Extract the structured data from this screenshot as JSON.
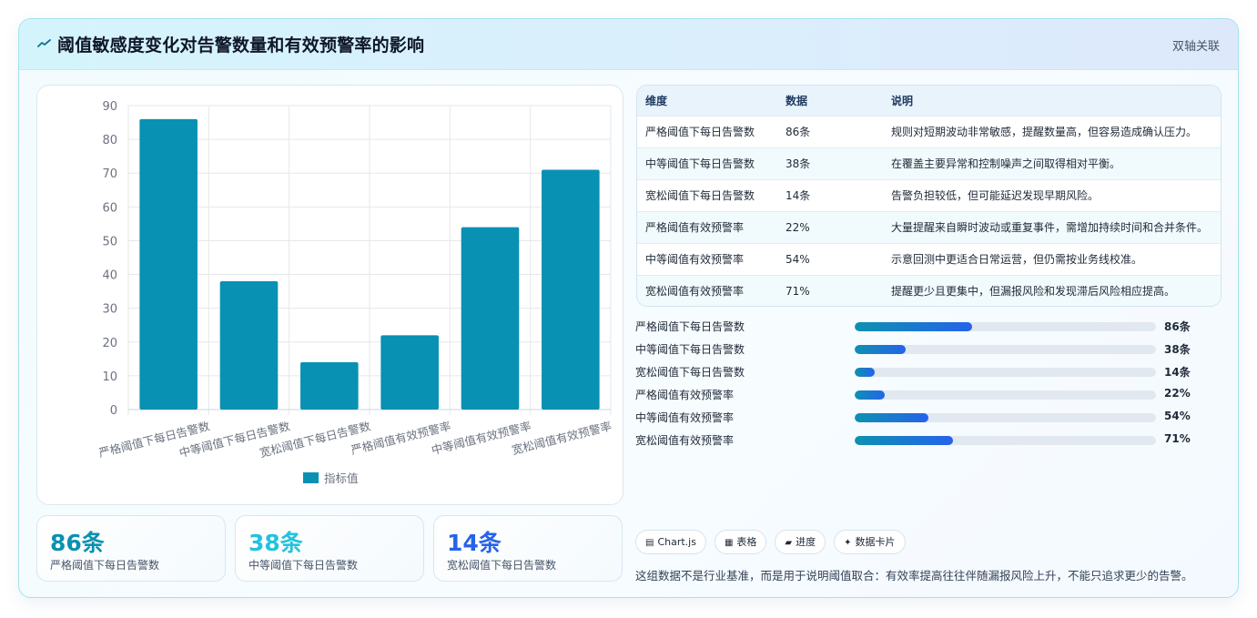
{
  "header": {
    "title": "阈值敏感度变化对告警数量和有效预警率的影响",
    "tag": "双轴关联"
  },
  "chart_data": {
    "type": "bar",
    "categories": [
      "严格阈值下每日告警数",
      "中等阈值下每日告警数",
      "宽松阈值下每日告警数",
      "严格阈值有效预警率",
      "中等阈值有效预警率",
      "宽松阈值有效预警率"
    ],
    "series": [
      {
        "name": "指标值",
        "values": [
          86,
          38,
          14,
          22,
          54,
          71
        ]
      }
    ],
    "ylim": [
      0,
      90
    ],
    "yticks": [
      0,
      10,
      20,
      30,
      40,
      50,
      60,
      70,
      80,
      90
    ],
    "grid": true,
    "legend": "bottom",
    "color": "#0891b2"
  },
  "table": {
    "headers": [
      "维度",
      "数据",
      "说明"
    ],
    "rows": [
      [
        "严格阈值下每日告警数",
        "86条",
        "规则对短期波动非常敏感，提醒数量高，但容易造成确认压力。"
      ],
      [
        "中等阈值下每日告警数",
        "38条",
        "在覆盖主要异常和控制噪声之间取得相对平衡。"
      ],
      [
        "宽松阈值下每日告警数",
        "14条",
        "告警负担较低，但可能延迟发现早期风险。"
      ],
      [
        "严格阈值有效预警率",
        "22%",
        "大量提醒来自瞬时波动或重复事件，需增加持续时间和合并条件。"
      ],
      [
        "中等阈值有效预警率",
        "54%",
        "示意回测中更适合日常运营，但仍需按业务线校准。"
      ],
      [
        "宽松阈值有效预警率",
        "71%",
        "提醒更少且更集中，但漏报风险和发现滞后风险相应提高。"
      ]
    ]
  },
  "progress": [
    {
      "label": "严格阈值下每日告警数",
      "value_text": "86条",
      "fraction": 0.39
    },
    {
      "label": "中等阈值下每日告警数",
      "value_text": "38条",
      "fraction": 0.17
    },
    {
      "label": "宽松阈值下每日告警数",
      "value_text": "14条",
      "fraction": 0.065
    },
    {
      "label": "严格阈值有效预警率",
      "value_text": "22%",
      "fraction": 0.1
    },
    {
      "label": "中等阈值有效预警率",
      "value_text": "54%",
      "fraction": 0.245
    },
    {
      "label": "宽松阈值有效预警率",
      "value_text": "71%",
      "fraction": 0.325
    }
  ],
  "stats": [
    {
      "value": "86条",
      "label": "严格阈值下每日告警数",
      "color": "#0891b2"
    },
    {
      "value": "38条",
      "label": "中等阈值下每日告警数",
      "color": "#22c3dd"
    },
    {
      "value": "14条",
      "label": "宽松阈值下每日告警数",
      "color": "#2563eb"
    }
  ],
  "chips": [
    {
      "icon": "chart-icon",
      "glyph": "▤",
      "label": "Chart.js"
    },
    {
      "icon": "table-icon",
      "glyph": "▦",
      "label": "表格"
    },
    {
      "icon": "progress-icon",
      "glyph": "▰",
      "label": "进度"
    },
    {
      "icon": "card-icon",
      "glyph": "✦",
      "label": "数据卡片"
    }
  ],
  "note": "这组数据不是行业基准，而是用于说明阈值取合：有效率提高往往伴随漏报风险上升，不能只追求更少的告警。"
}
